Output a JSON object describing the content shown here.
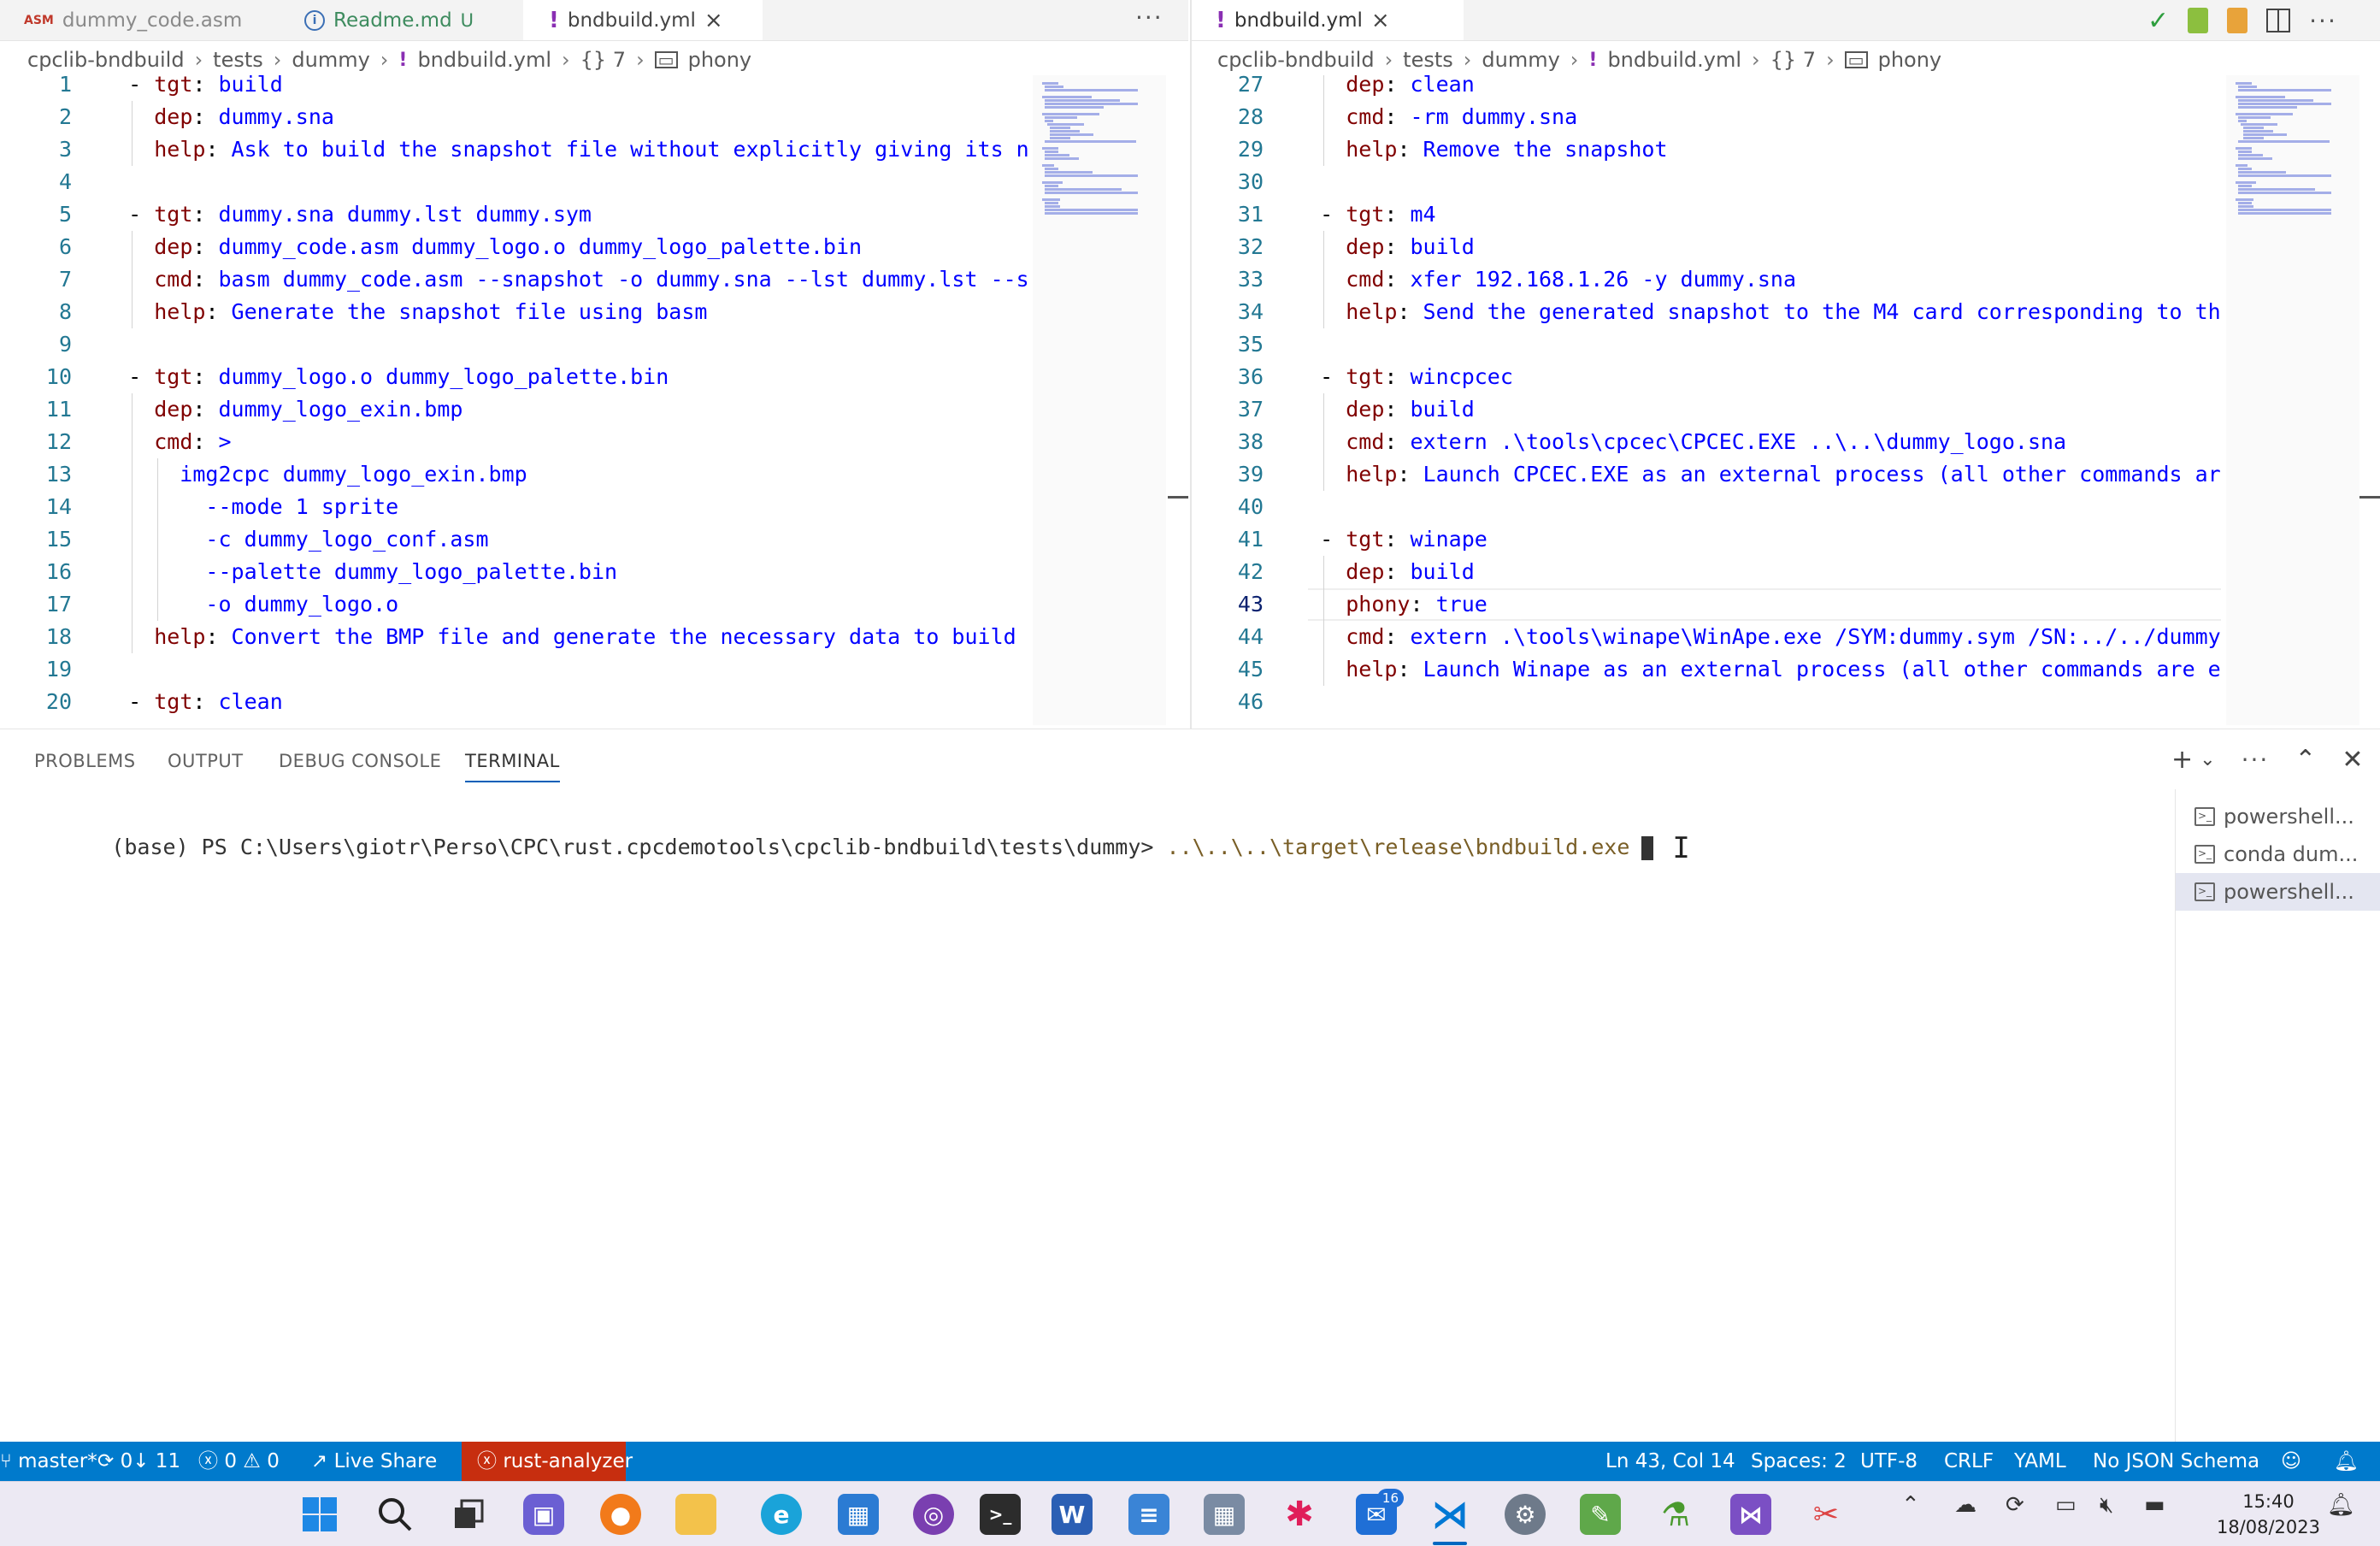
{
  "left_editor": {
    "tabs": [
      {
        "icon": "ASM",
        "label": "dummy_code.asm",
        "status": ""
      },
      {
        "icon": "i",
        "label": "Readme.md",
        "status": "U"
      },
      {
        "icon": "!",
        "label": "bndbuild.yml",
        "status": "×"
      }
    ],
    "more": "···",
    "breadcrumb": [
      "cpclib-bndbuild",
      "tests",
      "dummy",
      "bndbuild.yml",
      "{} 7",
      "phony"
    ],
    "lines": [
      {
        "n": "1",
        "t": "  - tgt: build"
      },
      {
        "n": "2",
        "t": "    dep: dummy.sna"
      },
      {
        "n": "3",
        "t": "    help: Ask to build the snapshot file without explicitly giving its n"
      },
      {
        "n": "4",
        "t": ""
      },
      {
        "n": "5",
        "t": "  - tgt: dummy.sna dummy.lst dummy.sym"
      },
      {
        "n": "6",
        "t": "    dep: dummy_code.asm dummy_logo.o dummy_logo_palette.bin"
      },
      {
        "n": "7",
        "t": "    cmd: basm dummy_code.asm --snapshot -o dummy.sna --lst dummy.lst --s"
      },
      {
        "n": "8",
        "t": "    help: Generate the snapshot file using basm"
      },
      {
        "n": "9",
        "t": ""
      },
      {
        "n": "10",
        "t": "  - tgt: dummy_logo.o dummy_logo_palette.bin"
      },
      {
        "n": "11",
        "t": "    dep: dummy_logo_exin.bmp"
      },
      {
        "n": "12",
        "t": "    cmd: >"
      },
      {
        "n": "13",
        "t": "      img2cpc dummy_logo_exin.bmp"
      },
      {
        "n": "14",
        "t": "        --mode 1 sprite"
      },
      {
        "n": "15",
        "t": "        -c dummy_logo_conf.asm"
      },
      {
        "n": "16",
        "t": "        --palette dummy_logo_palette.bin"
      },
      {
        "n": "17",
        "t": "        -o dummy_logo.o"
      },
      {
        "n": "18",
        "t": "    help: Convert the BMP file and generate the necessary data to build "
      },
      {
        "n": "19",
        "t": ""
      },
      {
        "n": "20",
        "t": "  - tgt: clean"
      }
    ]
  },
  "right_editor": {
    "tabs": [
      {
        "icon": "!",
        "label": "bndbuild.yml",
        "status": "×"
      }
    ],
    "breadcrumb": [
      "cpclib-bndbuild",
      "tests",
      "dummy",
      "bndbuild.yml",
      "{} 7",
      "phony"
    ],
    "current_line": "43",
    "lines": [
      {
        "n": "27",
        "t": "    dep: clean"
      },
      {
        "n": "28",
        "t": "    cmd: -rm dummy.sna"
      },
      {
        "n": "29",
        "t": "    help: Remove the snapshot"
      },
      {
        "n": "30",
        "t": ""
      },
      {
        "n": "31",
        "t": "  - tgt: m4"
      },
      {
        "n": "32",
        "t": "    dep: build"
      },
      {
        "n": "33",
        "t": "    cmd: xfer 192.168.1.26 -y dummy.sna"
      },
      {
        "n": "34",
        "t": "    help: Send the generated snapshot to the M4 card corresponding to th"
      },
      {
        "n": "35",
        "t": ""
      },
      {
        "n": "36",
        "t": "  - tgt: wincpcec"
      },
      {
        "n": "37",
        "t": "    dep: build"
      },
      {
        "n": "38",
        "t": "    cmd: extern .\\tools\\cpcec\\CPCEC.EXE ..\\..\\dummy_logo.sna"
      },
      {
        "n": "39",
        "t": "    help: Launch CPCEC.EXE as an external process (all other commands ar"
      },
      {
        "n": "40",
        "t": ""
      },
      {
        "n": "41",
        "t": "  - tgt: winape"
      },
      {
        "n": "42",
        "t": "    dep: build"
      },
      {
        "n": "43",
        "t": "    phony: true"
      },
      {
        "n": "44",
        "t": "    cmd: extern .\\tools\\winape\\WinApe.exe /SYM:dummy.sym /SN:../../dummy"
      },
      {
        "n": "45",
        "t": "    help: Launch Winape as an external process (all other commands are e"
      },
      {
        "n": "46",
        "t": ""
      }
    ]
  },
  "panel": {
    "tabs": [
      "PROBLEMS",
      "OUTPUT",
      "DEBUG CONSOLE",
      "TERMINAL"
    ],
    "active_tab": "TERMINAL",
    "terminal": {
      "prompt": "(base) PS C:\\Users\\giotr\\Perso\\CPC\\rust.cpcdemotools\\cpclib-bndbuild\\tests\\dummy> ",
      "command": "..\\..\\..\\target\\release\\bndbuild.exe"
    },
    "terminals": [
      "powershell...",
      "conda dum...",
      "powershell..."
    ],
    "selected_terminal": 2
  },
  "status_bar": {
    "branch": "master*",
    "sync": "0↓ 11",
    "errors": "0",
    "warnings": "0",
    "live_share": "Live Share",
    "rust_analyzer": "rust-analyzer",
    "position": "Ln 43, Col 14",
    "spaces": "Spaces: 2",
    "encoding": "UTF-8",
    "eol": "CRLF",
    "language": "YAML",
    "schema": "No JSON Schema"
  },
  "taskbar": {
    "time": "15:40",
    "date": "18/08/2023",
    "mail_badge": "16",
    "apps": [
      "windows-start",
      "search",
      "task-view",
      "teams-chat",
      "firefox",
      "file-explorer",
      "edge",
      "microsoft-store",
      "mask-app",
      "terminal",
      "word",
      "notepad",
      "calculator",
      "slack",
      "mail",
      "vscode",
      "settings",
      "paint",
      "conda",
      "visual-studio",
      "snipping-tool"
    ]
  },
  "colors": {
    "status_bar": "#007acc",
    "remote_indicator": "#c72e0f",
    "yaml_key": "#800000",
    "yaml_value": "#0000ff"
  }
}
